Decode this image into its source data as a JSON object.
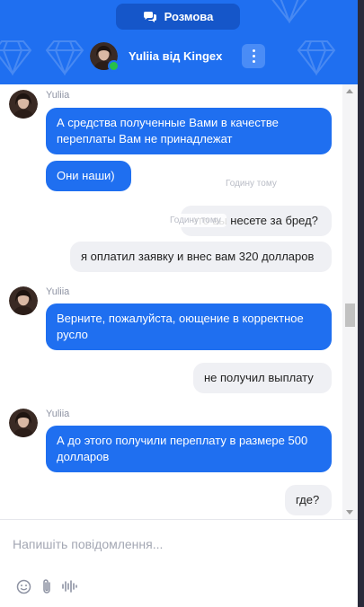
{
  "header": {
    "tab_label": "Розмова",
    "agent_name": "Yuliia від Kingex",
    "agent_online": true
  },
  "messages": [
    {
      "dir": "in",
      "sender": "Yuliia",
      "text": "А средства полученные Вами в качестве переплаты Вам не принадлежат"
    },
    {
      "dir": "in",
      "text": "Они наши)"
    },
    {
      "dir": "out",
      "text": "что вы несете за бред?"
    },
    {
      "dir": "out",
      "text": "я оплатил заявку и внес вам 320 долларов"
    },
    {
      "dir": "in",
      "sender": "Yuliia",
      "text": "Верните, пожалуйста, оющение в корректное русло"
    },
    {
      "dir": "out",
      "text": "не получил выплату"
    },
    {
      "dir": "in",
      "sender": "Yuliia",
      "text": "А до этого получили переплату в размере 500 долларов"
    },
    {
      "dir": "out",
      "text": "где?"
    }
  ],
  "timestamps": [
    "Годину тому",
    "Годину тому"
  ],
  "composer": {
    "placeholder": "Напишіть повідомлення..."
  },
  "colors": {
    "brand": "#1f6ff0",
    "incoming_bubble": "#1f6ff0",
    "outgoing_bubble": "#eff0f4",
    "online": "#27c04a"
  },
  "icons": [
    "chat-icon",
    "more-vertical-icon",
    "emoji-icon",
    "attachment-icon",
    "voice-icon"
  ]
}
